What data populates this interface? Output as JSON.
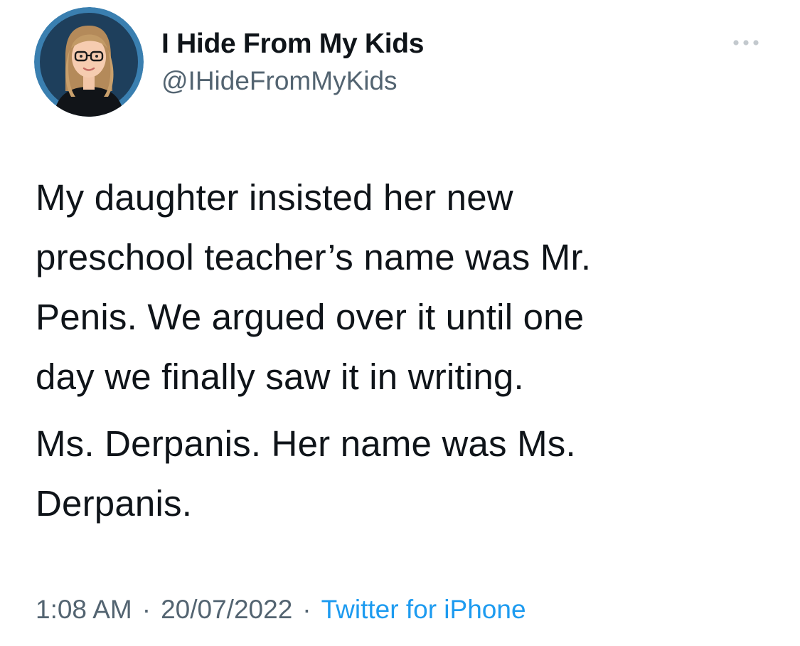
{
  "author": {
    "display_name": "I Hide From My Kids",
    "handle": "@IHideFromMyKids",
    "avatar_icon": "user-avatar-cartoon-woman-glasses"
  },
  "more_icon": "more-horizontal-icon",
  "tweet": {
    "paragraph_1": "My daughter insisted her new\npreschool teacher’s name was Mr.\nPenis. We argued over it until one\nday we finally saw it in writing.",
    "paragraph_2": "Ms. Derpanis. Her name was Ms.\nDerpanis."
  },
  "meta": {
    "time": "1:08 AM",
    "separator": "·",
    "date": "20/07/2022",
    "source": "Twitter for iPhone"
  },
  "colors": {
    "text": "#0f1419",
    "secondary": "#536471",
    "link": "#1d9bf0",
    "avatar_ring": "#3a7fb0",
    "avatar_bg": "#1e3f5c"
  }
}
